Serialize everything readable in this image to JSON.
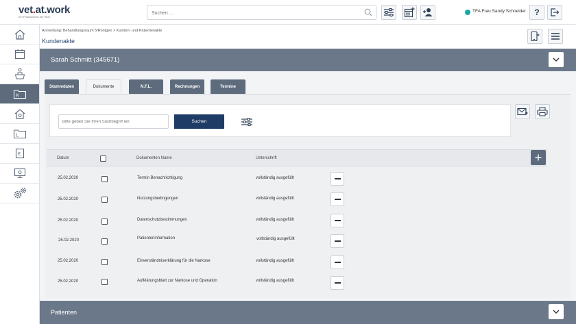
{
  "brand": {
    "name_left": "vet",
    "name_dot": ".",
    "name_right": "at.work",
    "tagline": "Ein Praxisschein der WDT"
  },
  "header": {
    "search_placeholder": "Suchen ...",
    "user_status_color": "#1aa6a6",
    "user_name": "TFA Frau Sandy Schneider"
  },
  "sidebar": {
    "items": [
      {
        "icon": "home-icon"
      },
      {
        "icon": "calendar-icon"
      },
      {
        "icon": "waiting-room-icon"
      },
      {
        "icon": "customer-folder-icon",
        "letter": "K",
        "active": true
      },
      {
        "icon": "practice-home-icon"
      },
      {
        "icon": "lab-folder-icon",
        "letter": "L"
      },
      {
        "icon": "billing-icon",
        "letter": "€"
      },
      {
        "icon": "monitor-icon"
      },
      {
        "icon": "settings-icon"
      }
    ]
  },
  "breadcrumb": "Anmeldung: Behandlungsraum 5/Röntgen > Kunden- und Patientenakte",
  "page_title": "Kundenakte",
  "patient": {
    "name": "Sarah Schmitt (345671)"
  },
  "tabs": [
    {
      "label": "Stammdaten"
    },
    {
      "label": "Dokumente",
      "active": true
    },
    {
      "label": "N.F.L."
    },
    {
      "label": "Rechnungen"
    },
    {
      "label": "Termine"
    }
  ],
  "documents": {
    "search_placeholder": "Bitte geben Sie Ihren Suchbegriff ein",
    "search_button": "Suchen",
    "columns": {
      "date": "Datum",
      "name": "Dokumenten Name",
      "signature": "Unterschrift"
    },
    "rows": [
      {
        "date": "25.02.2020",
        "name": "Termin Benachrichtigung",
        "signature": "vollständig ausgefüllt"
      },
      {
        "date": "25.02.2020",
        "name": "Nutzungsbedingungen",
        "signature": "vollständig ausgefüllt"
      },
      {
        "date": "25.02.2020",
        "name": "Datenschutzbestimmungen",
        "signature": "vollständig ausgefüllt"
      },
      {
        "date": "25.02.2020",
        "name": "Patienteninformation",
        "signature": "vollständig ausgefüllt"
      },
      {
        "date": "25.02.2020",
        "name": "Einverständniserklärung für die Narkose",
        "signature": "vollständig ausgefüllt"
      },
      {
        "date": "25.02.2020",
        "name": "Aufklärungsblatt zur Narkose und Operation",
        "signature": "vollständig ausgefüllt"
      }
    ]
  },
  "bottom_section": {
    "title": "Patienten"
  }
}
